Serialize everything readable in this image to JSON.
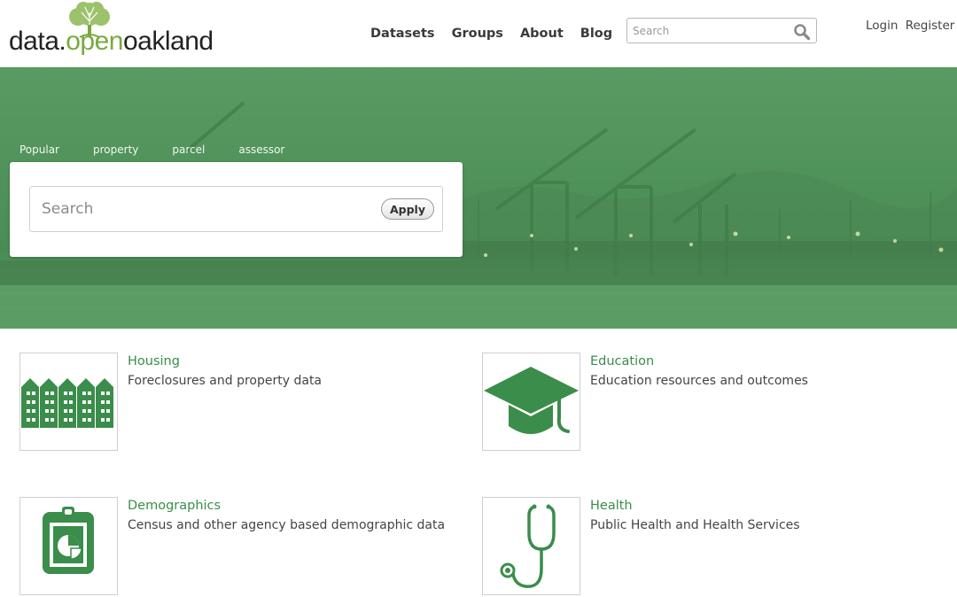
{
  "brand": {
    "logo_text_a": "data.",
    "logo_text_b": "open",
    "logo_text_c": "oakland",
    "accent_color": "#7aa940",
    "link_color": "#3a8d4a",
    "hero_color": "#4f9259"
  },
  "nav": {
    "items": [
      {
        "label": "Datasets"
      },
      {
        "label": "Groups"
      },
      {
        "label": "About"
      },
      {
        "label": "Blog"
      }
    ]
  },
  "header_search": {
    "placeholder": "Search",
    "icon": "magnifier-icon"
  },
  "account": {
    "login": "Login",
    "register": "Register"
  },
  "hero": {
    "popular_label": "Popular",
    "tags": [
      "property",
      "parcel",
      "assessor"
    ],
    "search_placeholder": "Search",
    "apply_label": "Apply"
  },
  "groups": [
    {
      "title": "Housing",
      "description": "Foreclosures and property data",
      "icon": "buildings-icon"
    },
    {
      "title": "Education",
      "description": "Education resources and outcomes",
      "icon": "graduation-cap-icon"
    },
    {
      "title": "Demographics",
      "description": "Census and other agency based demographic data",
      "icon": "report-chart-icon"
    },
    {
      "title": "Health",
      "description": "Public Health and Health Services",
      "icon": "stethoscope-icon"
    }
  ]
}
